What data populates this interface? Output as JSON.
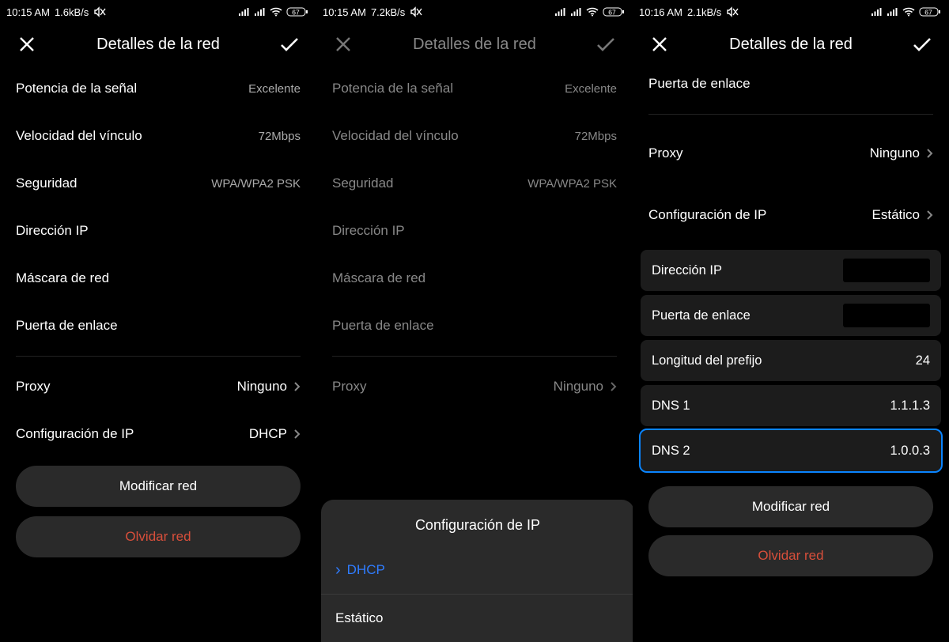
{
  "screen1": {
    "status": {
      "time": "10:15 AM",
      "speed": "1.6kB/s",
      "battery": "67"
    },
    "title": "Detalles de la red",
    "rows": {
      "signal_label": "Potencia de la señal",
      "signal_value": "Excelente",
      "linkspeed_label": "Velocidad del vínculo",
      "linkspeed_value": "72Mbps",
      "security_label": "Seguridad",
      "security_value": "WPA/WPA2 PSK",
      "ip_label": "Dirección IP",
      "mask_label": "Máscara de red",
      "gateway_label": "Puerta de enlace",
      "proxy_label": "Proxy",
      "proxy_value": "Ninguno",
      "ipconfig_label": "Configuración de IP",
      "ipconfig_value": "DHCP"
    },
    "buttons": {
      "modify": "Modificar red",
      "forget": "Olvidar red"
    }
  },
  "screen2": {
    "status": {
      "time": "10:15 AM",
      "speed": "7.2kB/s",
      "battery": "67"
    },
    "title": "Detalles de la red",
    "rows": {
      "signal_label": "Potencia de la señal",
      "signal_value": "Excelente",
      "linkspeed_label": "Velocidad del vínculo",
      "linkspeed_value": "72Mbps",
      "security_label": "Seguridad",
      "security_value": "WPA/WPA2 PSK",
      "ip_label": "Dirección IP",
      "mask_label": "Máscara de red",
      "gateway_label": "Puerta de enlace",
      "proxy_label": "Proxy",
      "proxy_value": "Ninguno"
    },
    "sheet": {
      "title": "Configuración de IP",
      "opt_dhcp": "DHCP",
      "opt_static": "Estático"
    }
  },
  "screen3": {
    "status": {
      "time": "10:16 AM",
      "speed": "2.1kB/s",
      "battery": "67"
    },
    "title": "Detalles de la red",
    "gateway_top": "Puerta de enlace",
    "rows": {
      "proxy_label": "Proxy",
      "proxy_value": "Ninguno",
      "ipconfig_label": "Configuración de IP",
      "ipconfig_value": "Estático"
    },
    "inputs": {
      "ip_label": "Dirección IP",
      "gateway_label": "Puerta de enlace",
      "prefix_label": "Longitud del prefijo",
      "prefix_value": "24",
      "dns1_label": "DNS 1",
      "dns1_value": "1.1.1.3",
      "dns2_label": "DNS 2",
      "dns2_value": "1.0.0.3"
    },
    "buttons": {
      "modify": "Modificar red",
      "forget": "Olvidar red"
    }
  }
}
